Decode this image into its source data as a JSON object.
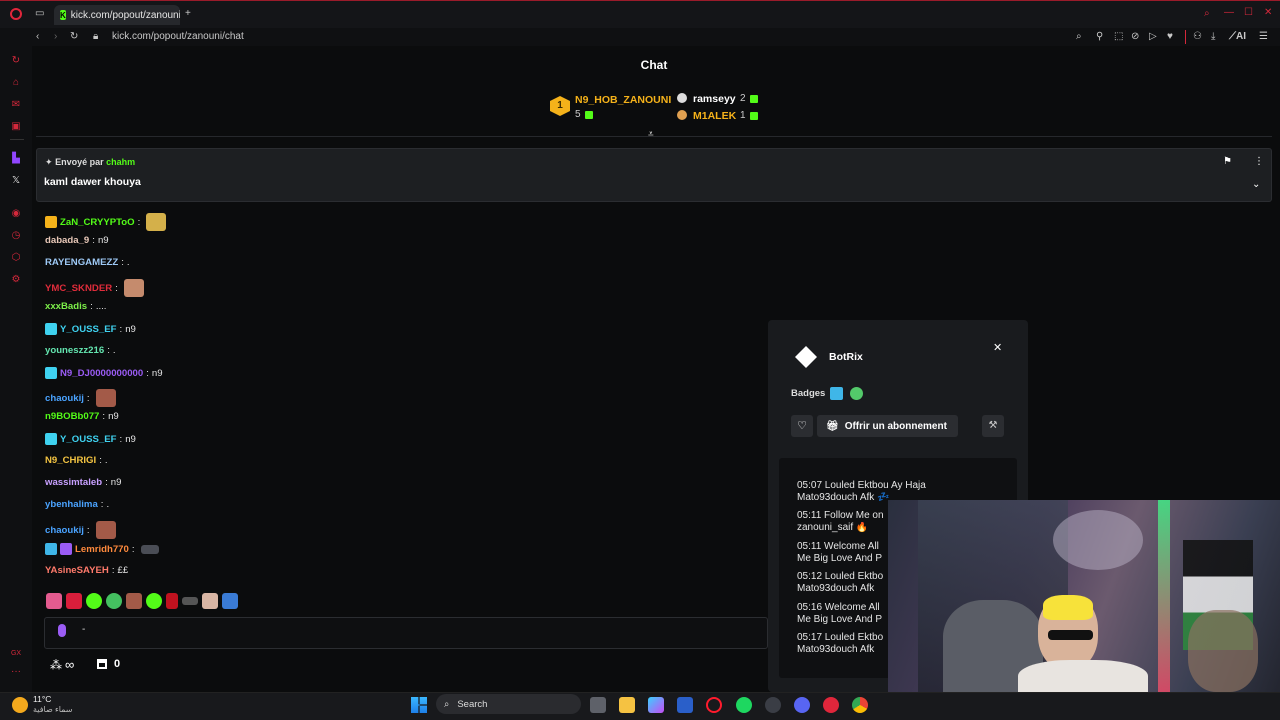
{
  "browser": {
    "tab_title": "kick.com/popout/zanouni/",
    "url": "kick.com/popout/zanouni/chat",
    "ai_label": "AI",
    "new_tab": "+"
  },
  "chat": {
    "title": "Chat",
    "gifters": [
      {
        "rank": "1",
        "name": "N9_HOB_ZANOUNI",
        "count": "5",
        "color": "#f5b21a"
      },
      {
        "name": "ramseyy",
        "count": "2",
        "color": "#ffffff"
      },
      {
        "name": "M1ALEK",
        "count": "1",
        "color": "#f5b21a"
      }
    ],
    "pinned": {
      "sent_by_label": "Envoyé par",
      "sent_by_user": "chahm",
      "message": "kaml dawer khouya"
    },
    "messages": [
      {
        "user": "ZaN_CRYYPToO",
        "text": "",
        "color": "#53fc18",
        "sep": ":"
      },
      {
        "user": "dabada_9",
        "text": "n9",
        "color": "#e8c8b8",
        "sep": ":"
      },
      {
        "user": "RAYENGAMEZZ",
        "text": ".",
        "color": "#9ec9f5",
        "sep": ":"
      },
      {
        "user": "YMC_SKNDER",
        "text": "",
        "color": "#e02c3b",
        "sep": ":"
      },
      {
        "user": "xxxBadis",
        "text": "....",
        "color": "#7df04a",
        "sep": ":"
      },
      {
        "user": "Y_OUSS_EF",
        "text": "n9",
        "color": "#3fd2f0",
        "sep": ":"
      },
      {
        "user": "youneszz216",
        "text": ".",
        "color": "#64e6b0",
        "sep": ":"
      },
      {
        "user": "N9_DJ0000000000",
        "text": "n9",
        "color": "#9b5cf5",
        "sep": ":"
      },
      {
        "user": "chaoukij",
        "text": "",
        "color": "#4aa3ff",
        "sep": ":"
      },
      {
        "user": "n9BOBb077",
        "text": "n9",
        "color": "#53fc18",
        "sep": ":"
      },
      {
        "user": "Y_OUSS_EF",
        "text": "n9",
        "color": "#3fd2f0",
        "sep": ":"
      },
      {
        "user": "N9_CHRIGI",
        "text": ".",
        "color": "#f5c542",
        "sep": ":"
      },
      {
        "user": "wassimtaleb",
        "text": "n9",
        "color": "#c8a0ff",
        "sep": ":"
      },
      {
        "user": "ybenhalima",
        "text": ".",
        "color": "#4aa3ff",
        "sep": ":"
      },
      {
        "user": "chaoukij",
        "text": "",
        "color": "#4aa3ff",
        "sep": ":"
      },
      {
        "user": "Lemridh770",
        "text": "",
        "color": "#ff8a3d",
        "sep": ":"
      },
      {
        "user": "YAsineSAYEH",
        "text": "££",
        "color": "#ff7a6b",
        "sep": ":"
      }
    ],
    "input_text": "-",
    "footer_count": "0",
    "footer_infinity": "∞"
  },
  "popup": {
    "name": "BotRix",
    "badges_label": "Badges",
    "gift_label": "Offrir un abonnement",
    "close": "✕",
    "log": [
      {
        "l1": "05:07 Louled Ektbou Ay Haja",
        "l2": "Mato93douch Afk 💤"
      },
      {
        "l1": "05:11 Follow Me on",
        "l2": "zanouni_saif 🔥"
      },
      {
        "l1": "05:11 Welcome All",
        "l2": "Me Big Love And P"
      },
      {
        "l1": "05:12 Louled Ektbo",
        "l2": "Mato93douch Afk"
      },
      {
        "l1": "05:16 Welcome All",
        "l2": "Me Big Love And P"
      },
      {
        "l1": "05:17 Louled Ektbo",
        "l2": "Mato93douch Afk"
      }
    ]
  },
  "taskbar": {
    "weather_temp": "11°C",
    "weather_desc": "سماء صافية",
    "search": "Search"
  }
}
